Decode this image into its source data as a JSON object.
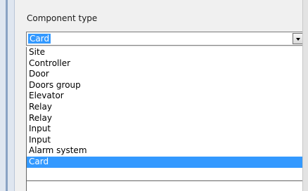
{
  "panel": {
    "label": "Component type",
    "combo": {
      "value": "Card"
    }
  },
  "dropdown": {
    "items": [
      "Site",
      "Controller",
      "Door",
      "Doors group",
      "Elevator",
      "Relay",
      "Relay",
      "Input",
      "Input",
      "Alarm system",
      "Card"
    ],
    "selected_index": 10
  },
  "colors": {
    "selection": "#3399ff",
    "background": "#f0f0f0"
  },
  "icons": {
    "combo_button": "chevron-down-icon"
  }
}
